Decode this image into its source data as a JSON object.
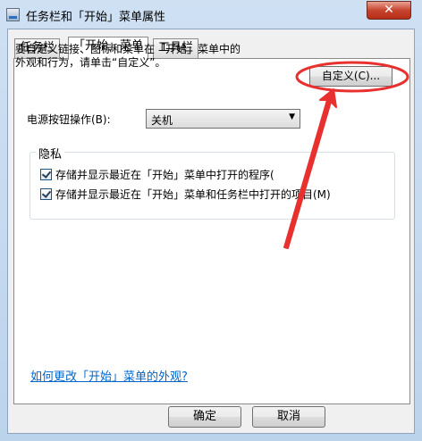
{
  "window": {
    "title": "任务栏和「开始」菜单属性",
    "close_symbol": "✕"
  },
  "tabs": [
    {
      "label": "任务栏"
    },
    {
      "label": "「开始」菜单"
    },
    {
      "label": "工具栏"
    }
  ],
  "main": {
    "intro_line1": "要自定义链接、图标和菜单在「开始」菜单中的",
    "intro_line2": "外观和行为，请单击“自定义”。",
    "customize_button": "自定义(C)...",
    "power_label": "电源按钮操作(B):",
    "power_value": "关机",
    "privacy_title": "隐私",
    "privacy_options": [
      {
        "label": "存储并显示最近在「开始」菜单中打开的程序(",
        "checked": true
      },
      {
        "label": "存储并显示最近在「开始」菜单和任务栏中打开的项目(M)",
        "checked": true
      }
    ],
    "help_link": "如何更改「开始」菜单的外观?"
  },
  "footer": {
    "ok": "确定",
    "cancel": "取消"
  },
  "colors": {
    "annotation_red": "#e8302e",
    "link": "#0066cc"
  }
}
